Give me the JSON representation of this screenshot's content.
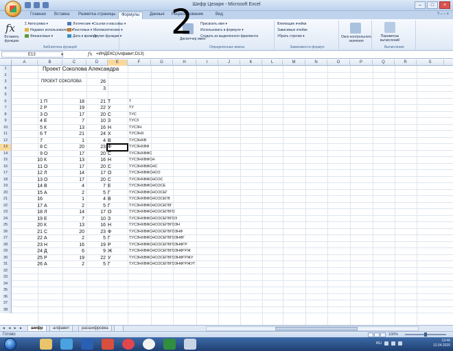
{
  "window": {
    "title": "Шифр Цезаря - Microsoft Excel",
    "controls": [
      "–",
      "□",
      "×"
    ]
  },
  "ribbon_tabs": [
    {
      "label": "Главная"
    },
    {
      "label": "Вставка"
    },
    {
      "label": "Разметка страницы"
    },
    {
      "label": "Формулы"
    },
    {
      "label": "Данные"
    },
    {
      "label": "Рецензирование"
    },
    {
      "label": "Вид"
    }
  ],
  "ribbon_help": "? – ▫ ×",
  "overlay_number": "2",
  "ribbon": {
    "insert_function": "Вставить функцию",
    "library_items": [
      "Σ Автосумма ▾",
      "Недавно использовались ▾",
      "Финансовые ▾",
      "Логические ▾",
      "Текстовые ▾",
      "Дата и время ▾",
      "Ссылки и массивы ▾",
      "Математические ▾",
      "Другие функции ▾"
    ],
    "library_label": "Библиотека функций",
    "names_items": [
      "Присвоить имя ▾",
      "Использовать в формуле ▾",
      "Создать из выделенного фрагмента"
    ],
    "names_manager": "Диспетчер имен",
    "names_label": "Определенные имена",
    "audit_items": [
      "Влияющие ячейки",
      "Зависимые ячейки",
      "Убрать стрелки ▾"
    ],
    "audit_label": "Зависимости формул",
    "watch_window": "Окно контрольного значения",
    "calc_params": "Параметры вычислений",
    "calc_label": "Вычисление"
  },
  "formula_bar": {
    "name_box": "E13",
    "formula": "=ИНДЕКС(Алфавит;D13)"
  },
  "columns": [
    "A",
    "B",
    "C",
    "D",
    "E",
    "F",
    "G",
    "H",
    "I",
    "J",
    "K",
    "L",
    "M",
    "N",
    "O",
    "P",
    "Q",
    "R",
    "S"
  ],
  "selected_column": "E",
  "selected_row": "13",
  "rows": [
    {
      "n": "1",
      "a": "",
      "b": "Проект Соколова Александра",
      "c": "",
      "d": "",
      "e": "",
      "f": ""
    },
    {
      "n": "2",
      "a": "",
      "b": "",
      "c": "",
      "d": "",
      "e": "",
      "f": ""
    },
    {
      "n": "3",
      "a": "",
      "b": "ПРОЕКТ СОКОЛОВА",
      "c": "",
      "d": "26",
      "e": "",
      "f": ""
    },
    {
      "n": "4",
      "a": "",
      "b": "",
      "c": "",
      "d": "3",
      "e": "",
      "f": ""
    },
    {
      "n": "5",
      "a": "",
      "b": "",
      "c": "",
      "d": "",
      "e": "",
      "f": ""
    },
    {
      "n": "6",
      "a": "1",
      "b": "П",
      "c": "18",
      "d": "21",
      "e": "Т",
      "f": "Т"
    },
    {
      "n": "7",
      "a": "2",
      "b": "Р",
      "c": "19",
      "d": "22",
      "e": "У",
      "f": "ТУ"
    },
    {
      "n": "8",
      "a": "3",
      "b": "О",
      "c": "17",
      "d": "20",
      "e": "С",
      "f": "ТУС"
    },
    {
      "n": "9",
      "a": "4",
      "b": "Е",
      "c": "7",
      "d": "10",
      "e": "З",
      "f": "ТУСЗ"
    },
    {
      "n": "10",
      "a": "5",
      "b": "К",
      "c": "13",
      "d": "16",
      "e": "Н",
      "f": "ТУСЗН"
    },
    {
      "n": "11",
      "a": "6",
      "b": "Т",
      "c": "21",
      "d": "24",
      "e": "Х",
      "f": "ТУСЗНХ"
    },
    {
      "n": "12",
      "a": "7",
      "b": "",
      "c": "1",
      "d": "4",
      "e": "В",
      "f": "ТУСЗНХВ"
    },
    {
      "n": "13",
      "a": "8",
      "b": "С",
      "c": "20",
      "d": "23",
      "e": "Ф",
      "f": "ТУСЗНХВФ"
    },
    {
      "n": "14",
      "a": "9",
      "b": "О",
      "c": "17",
      "d": "20",
      "e": "С",
      "f": "ТУСЗНХВФС"
    },
    {
      "n": "15",
      "a": "10",
      "b": "К",
      "c": "13",
      "d": "16",
      "e": "Н",
      "f": "ТУСЗНХВФСН"
    },
    {
      "n": "16",
      "a": "11",
      "b": "О",
      "c": "17",
      "d": "20",
      "e": "С",
      "f": "ТУСЗНХВФСНС"
    },
    {
      "n": "17",
      "a": "12",
      "b": "Л",
      "c": "14",
      "d": "17",
      "e": "О",
      "f": "ТУСЗНХВФСНСО"
    },
    {
      "n": "18",
      "a": "13",
      "b": "О",
      "c": "17",
      "d": "20",
      "e": "С",
      "f": "ТУСЗНХВФСНСОС"
    },
    {
      "n": "19",
      "a": "14",
      "b": "В",
      "c": "4",
      "d": "7",
      "e": "Е",
      "f": "ТУСЗНХВФСНСОСЕ"
    },
    {
      "n": "20",
      "a": "15",
      "b": "А",
      "c": "2",
      "d": "5",
      "e": "Г",
      "f": "ТУСЗНХВФСНСОСЕГ"
    },
    {
      "n": "21",
      "a": "16",
      "b": "",
      "c": "1",
      "d": "4",
      "e": "В",
      "f": "ТУСЗНХВФСНСОСЕГВ"
    },
    {
      "n": "22",
      "a": "17",
      "b": "А",
      "c": "2",
      "d": "5",
      "e": "Г",
      "f": "ТУСЗНХВФСНСОСЕГВГ"
    },
    {
      "n": "23",
      "a": "18",
      "b": "Л",
      "c": "14",
      "d": "17",
      "e": "О",
      "f": "ТУСЗНХВФСНСОСЕГВГО"
    },
    {
      "n": "24",
      "a": "19",
      "b": "Е",
      "c": "7",
      "d": "10",
      "e": "З",
      "f": "ТУСЗНХВФСНСОСЕГВГОЗ"
    },
    {
      "n": "25",
      "a": "20",
      "b": "К",
      "c": "13",
      "d": "16",
      "e": "Н",
      "f": "ТУСЗНХВФСНСОСЕГВГОЗН"
    },
    {
      "n": "26",
      "a": "21",
      "b": "С",
      "c": "20",
      "d": "23",
      "e": "Ф",
      "f": "ТУСЗНХВФСНСОСЕГВГОЗНФ"
    },
    {
      "n": "27",
      "a": "22",
      "b": "А",
      "c": "2",
      "d": "5",
      "e": "Г",
      "f": "ТУСЗНХВФСНСОСЕГВГОЗНФГ"
    },
    {
      "n": "28",
      "a": "23",
      "b": "Н",
      "c": "16",
      "d": "19",
      "e": "Р",
      "f": "ТУСЗНХВФСНСОСЕГВГОЗНФГР"
    },
    {
      "n": "29",
      "a": "24",
      "b": "Д",
      "c": "6",
      "d": "9",
      "e": "Ж",
      "f": "ТУСЗНХВФСНСОСЕГВГОЗНФГРЖ"
    },
    {
      "n": "30",
      "a": "25",
      "b": "Р",
      "c": "19",
      "d": "22",
      "e": "У",
      "f": "ТУСЗНХВФСНСОСЕГВГОЗНФГРЖУ"
    },
    {
      "n": "31",
      "a": "26",
      "b": "А",
      "c": "2",
      "d": "5",
      "e": "Г",
      "f": "ТУСЗНХВФСНСОСЕГВГОЗНФГРЖУГ"
    },
    {
      "n": "32",
      "a": "",
      "b": "",
      "c": "",
      "d": "",
      "e": "",
      "f": ""
    },
    {
      "n": "33",
      "a": "",
      "b": "",
      "c": "",
      "d": "",
      "e": "",
      "f": ""
    },
    {
      "n": "34",
      "a": "",
      "b": "",
      "c": "",
      "d": "",
      "e": "",
      "f": ""
    },
    {
      "n": "35",
      "a": "",
      "b": "",
      "c": "",
      "d": "",
      "e": "",
      "f": ""
    },
    {
      "n": "36",
      "a": "",
      "b": "",
      "c": "",
      "d": "",
      "e": "",
      "f": ""
    },
    {
      "n": "37",
      "a": "",
      "b": "",
      "c": "",
      "d": "",
      "e": "",
      "f": ""
    },
    {
      "n": "38",
      "a": "",
      "b": "",
      "c": "",
      "d": "",
      "e": "",
      "f": ""
    }
  ],
  "sheet_tabs": [
    {
      "label": "шифр",
      "active": true
    },
    {
      "label": "алфавит",
      "active": false
    },
    {
      "label": "расшифровка",
      "active": false
    }
  ],
  "status": {
    "ready": "Готово",
    "zoom": "100%"
  },
  "taskbar": {
    "lang": "RU",
    "time": "13:46",
    "date": "12.04.2020"
  }
}
